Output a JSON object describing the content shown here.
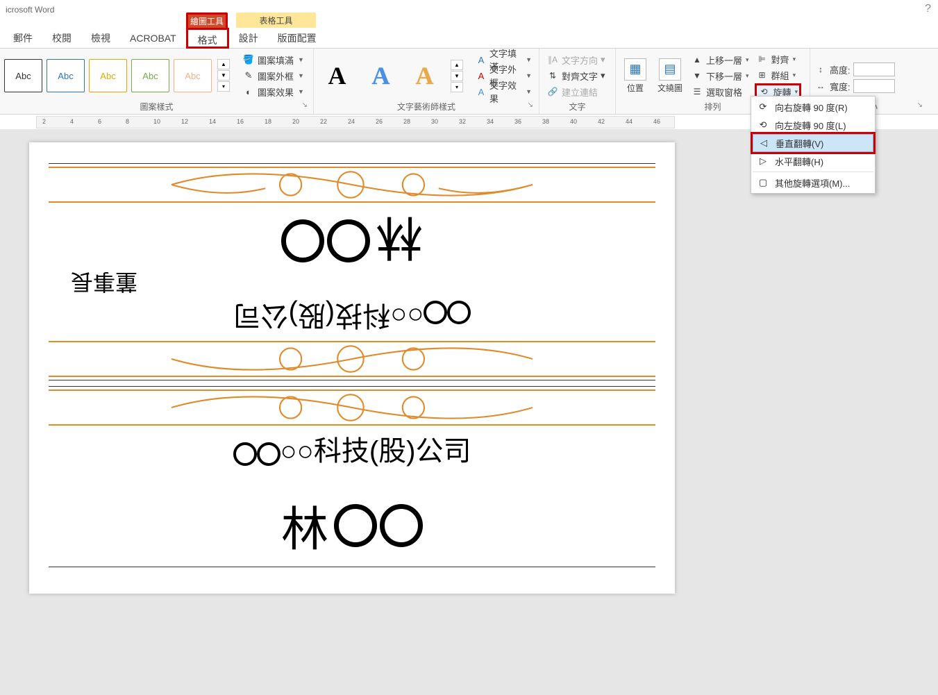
{
  "titlebar": {
    "app": "icrosoft Word",
    "help": "?"
  },
  "context_tabs": {
    "drawing": "繪圖工具",
    "table": "表格工具"
  },
  "tabs": {
    "mail": "郵件",
    "review": "校閱",
    "view": "檢視",
    "acrobat": "ACROBAT",
    "format": "格式",
    "design": "設計",
    "layout": "版面配置"
  },
  "shape_styles": {
    "label": "圖案樣式",
    "thumb": "Abc",
    "fill": "圖案填滿",
    "outline": "圖案外框",
    "effects": "圖案效果"
  },
  "wordart": {
    "label": "文字藝術師樣式",
    "thumb": "A",
    "fill": "文字填滿",
    "outline": "文字外框",
    "effects": "文字效果"
  },
  "text": {
    "label": "文字",
    "direction": "文字方向",
    "align": "對齊文字",
    "link": "建立連結"
  },
  "arrange": {
    "label": "排列",
    "position": "位置",
    "wrap": "文繞圖",
    "forward": "上移一層",
    "backward": "下移一層",
    "pane": "選取窗格",
    "align": "對齊",
    "group": "群組",
    "rotate": "旋轉"
  },
  "size": {
    "label": "大小",
    "height": "高度:",
    "width": "寬度:"
  },
  "rotate_menu": {
    "right90": "向右旋轉 90 度(R)",
    "left90": "向左旋轉 90 度(L)",
    "flipv": "垂直翻轉(V)",
    "fliph": "水平翻轉(H)",
    "more": "其他旋轉選項(M)..."
  },
  "ruler": [
    "2",
    "4",
    "6",
    "8",
    "10",
    "12",
    "14",
    "16",
    "18",
    "20",
    "22",
    "24",
    "26",
    "28",
    "30",
    "32",
    "34",
    "36",
    "38",
    "40",
    "42",
    "44",
    "46"
  ],
  "doc": {
    "side": "董事長",
    "name_main": "林",
    "company": "○○科技(股)公司",
    "name2": "林"
  }
}
